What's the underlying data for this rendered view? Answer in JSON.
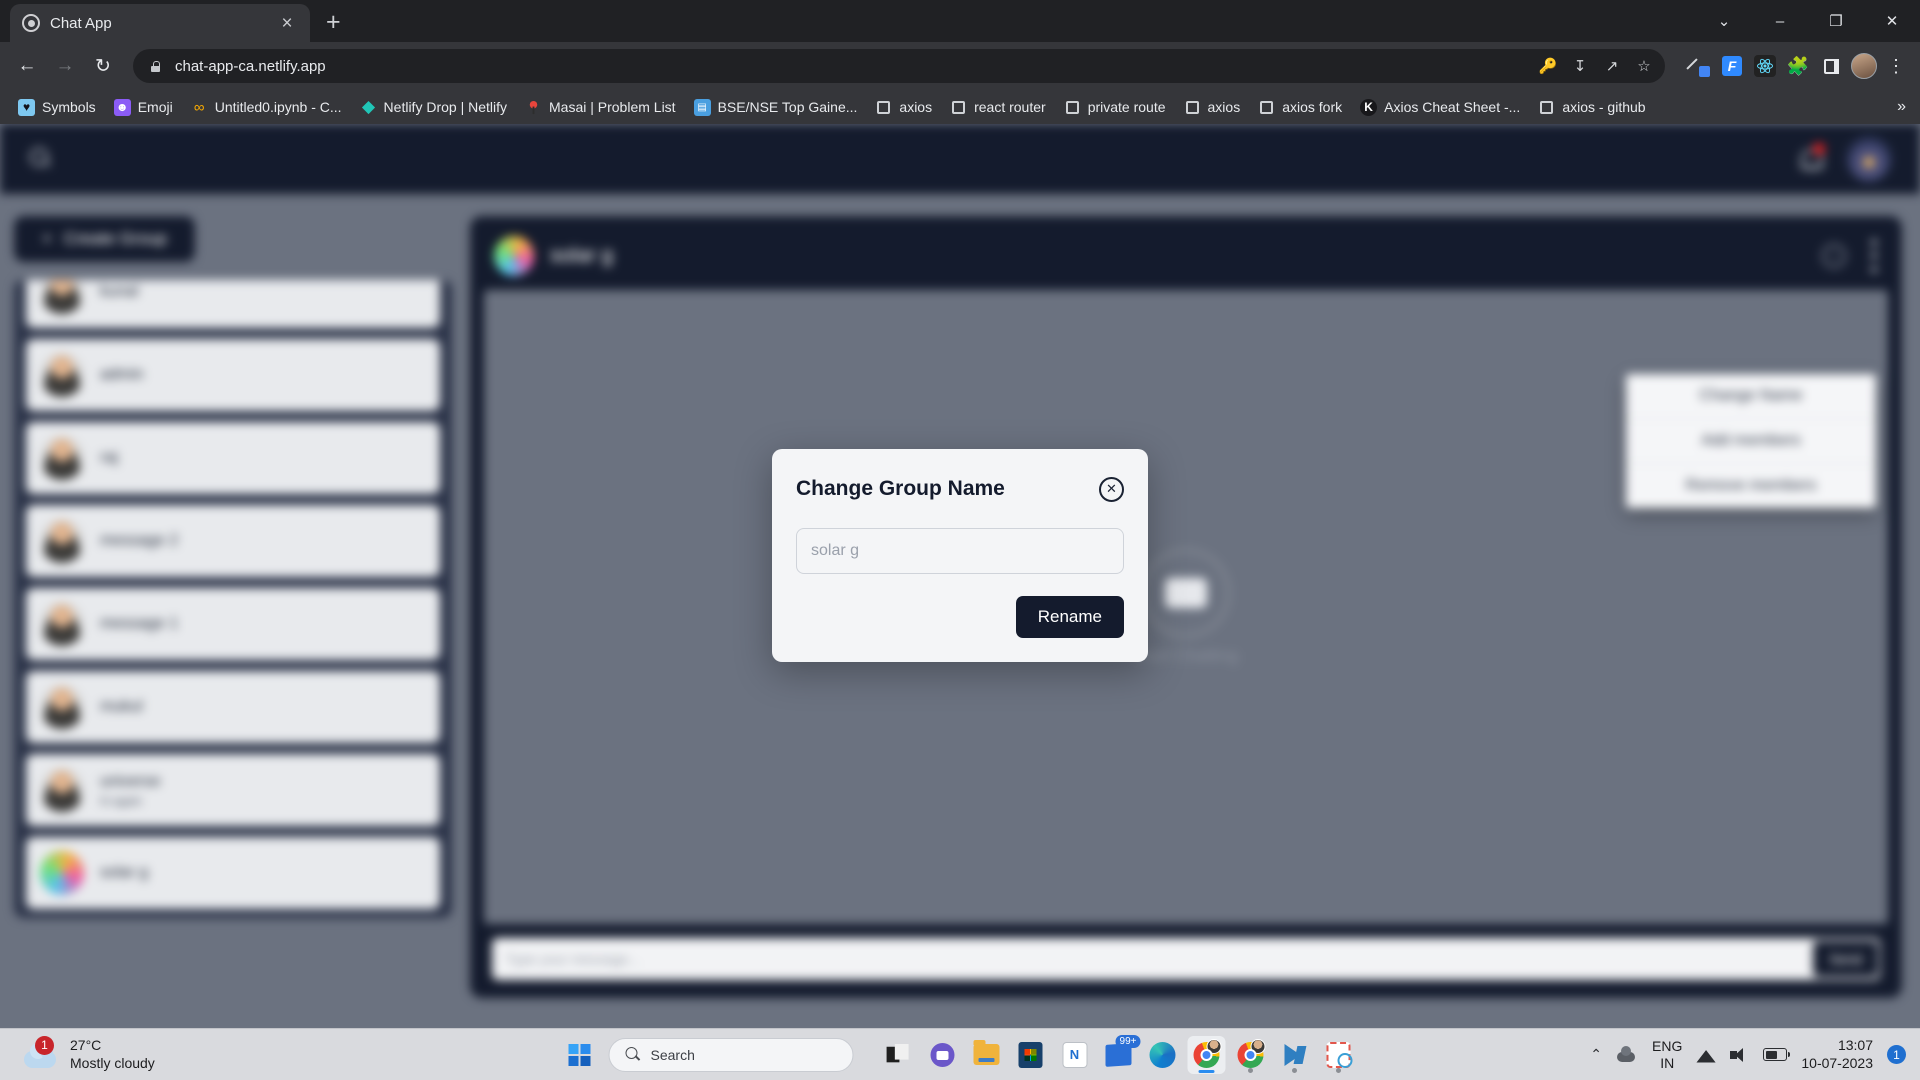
{
  "browser": {
    "tab": {
      "title": "Chat App",
      "favicon": "chat-app-favicon",
      "close_label": "×"
    },
    "new_tab_label": "+",
    "window_controls": {
      "minimize_extra": "⌄",
      "minimize": "–",
      "maximize": "❐",
      "close": "✕"
    },
    "nav": {
      "back": "←",
      "forward": "→",
      "reload": "↻"
    },
    "omnibox": {
      "url": "chat-app-ca.netlify.app",
      "lock": "site-secure-lock"
    },
    "omnibox_actions": [
      "key-icon",
      "install-icon",
      "share-icon",
      "bookmark-star-icon"
    ],
    "extensions": [
      "eyedropper-icon",
      "F",
      "react-devtools-icon",
      "extensions-puzzle-icon",
      "side-panel-icon"
    ],
    "profile": "profile-avatar",
    "menu": "⋮",
    "bookmarks": [
      {
        "label": "Symbols",
        "icon": "heart"
      },
      {
        "label": "Emoji",
        "icon": "emoji"
      },
      {
        "label": "Untitled0.ipynb - C...",
        "icon": "colab"
      },
      {
        "label": "Netlify Drop | Netlify",
        "icon": "netlify-diamond"
      },
      {
        "label": "Masai | Problem List",
        "icon": "masai"
      },
      {
        "label": "BSE/NSE Top Gaine...",
        "icon": "sheet"
      },
      {
        "label": "axios",
        "icon": "blank"
      },
      {
        "label": "react router",
        "icon": "blank"
      },
      {
        "label": "private route",
        "icon": "blank"
      },
      {
        "label": "axios",
        "icon": "blank"
      },
      {
        "label": "axios fork",
        "icon": "blank"
      },
      {
        "label": "Axios Cheat Sheet -...",
        "icon": "kindacode"
      },
      {
        "label": "axios - github",
        "icon": "blank"
      }
    ],
    "bookmarks_overflow": "»"
  },
  "app": {
    "navbar": {
      "search_icon": "search-icon",
      "notification_icon": "bell-icon",
      "notification_badge": "",
      "avatar": "user-avatar"
    },
    "sidebar": {
      "create_group_label": "Create Group",
      "create_group_icon": "+",
      "chats": [
        {
          "name": "kunal",
          "sub": "",
          "avatar": "person"
        },
        {
          "name": "admin",
          "sub": "",
          "avatar": "person"
        },
        {
          "name": "raj",
          "sub": "",
          "avatar": "person"
        },
        {
          "name": "message 2",
          "sub": "",
          "avatar": "person"
        },
        {
          "name": "message 1",
          "sub": "",
          "avatar": "person"
        },
        {
          "name": "mukul",
          "sub": "",
          "avatar": "person"
        },
        {
          "name": "universe",
          "sub": "hi again",
          "avatar": "person"
        },
        {
          "name": "solar g",
          "sub": "",
          "avatar": "group"
        }
      ]
    },
    "chat": {
      "header": {
        "group_name": "solar g",
        "avatar": "group-avatar",
        "info_icon": "info-icon",
        "menu_icon": "vertical-dots-icon"
      },
      "empty_state": {
        "text": "Start Chatting",
        "icon": "chat-bubble-logo"
      },
      "composer": {
        "placeholder": "Type your message...",
        "send_label": "Send",
        "emoji_icon": "emoji-icon"
      }
    },
    "dropdown": {
      "items": [
        "Change Name",
        "Add members",
        "Remove members"
      ]
    },
    "modal": {
      "title": "Change Group Name",
      "close_icon": "✕",
      "input_placeholder": "solar g",
      "input_value": "",
      "submit_label": "Rename"
    }
  },
  "taskbar": {
    "weather": {
      "temperature": "27°C",
      "description": "Mostly cloudy",
      "badge": "1"
    },
    "start": "windows-start-icon",
    "search": {
      "placeholder": "Search",
      "icon": "search-icon"
    },
    "apps": [
      {
        "name": "task-view",
        "badge": "",
        "running": false
      },
      {
        "name": "teams-chat",
        "badge": "",
        "running": false
      },
      {
        "name": "file-explorer",
        "badge": "",
        "running": false
      },
      {
        "name": "microsoft-store",
        "badge": "",
        "running": false
      },
      {
        "name": "onenote",
        "badge": "",
        "running": false
      },
      {
        "name": "mail",
        "badge": "99+",
        "running": false
      },
      {
        "name": "microsoft-edge",
        "badge": "",
        "running": false
      },
      {
        "name": "google-chrome-active",
        "badge": "",
        "running": true
      },
      {
        "name": "google-chrome",
        "badge": "",
        "running": true
      },
      {
        "name": "visual-studio-code",
        "badge": "",
        "running": true
      },
      {
        "name": "snipping-tool",
        "badge": "",
        "running": true
      }
    ],
    "tray": {
      "chevron": "⌃",
      "onedrive": "onedrive-icon",
      "language": {
        "line1": "ENG",
        "line2": "IN"
      },
      "wifi": "wifi-icon",
      "volume": "volume-icon",
      "battery": "battery-icon",
      "time": "13:07",
      "date": "10-07-2023",
      "notification_count": "1"
    }
  }
}
